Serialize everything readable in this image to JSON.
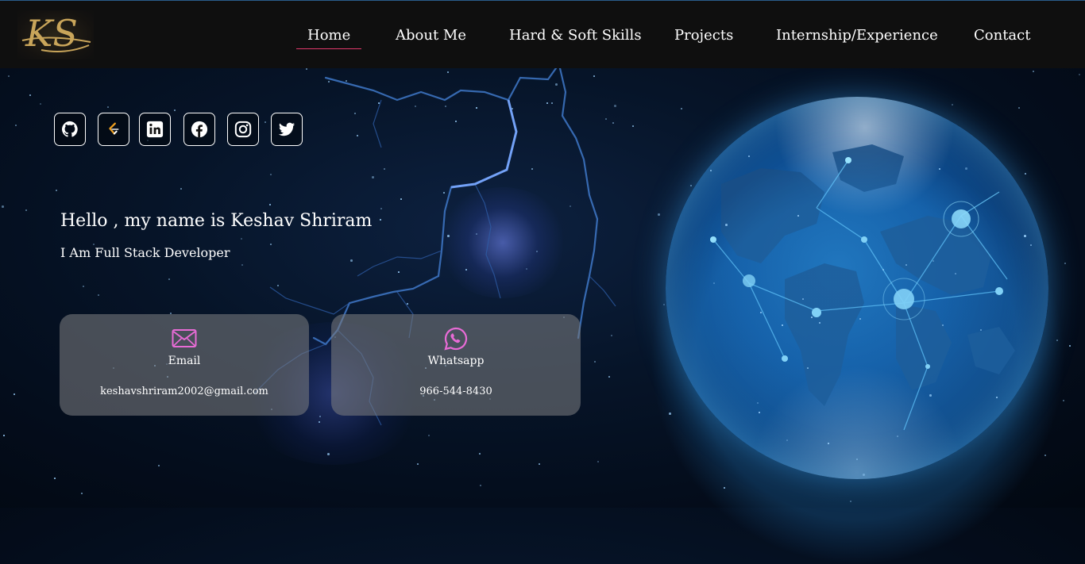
{
  "brand": {
    "logo_text": "KS"
  },
  "nav": {
    "items": [
      {
        "label": "Home",
        "active": true
      },
      {
        "label": "About Me",
        "active": false
      },
      {
        "label": "Hard & Soft Skills",
        "active": false
      },
      {
        "label": "Projects",
        "active": false
      },
      {
        "label": "Internship/Experience",
        "active": false
      },
      {
        "label": "Contact",
        "active": false
      }
    ],
    "active_underline_color": "#e23a6b"
  },
  "socials": [
    {
      "icon": "github-icon"
    },
    {
      "icon": "leetcode-icon"
    },
    {
      "icon": "linkedin-icon"
    },
    {
      "icon": "facebook-icon"
    },
    {
      "icon": "instagram-icon"
    },
    {
      "icon": "twitter-icon"
    }
  ],
  "hero": {
    "greeting": "Hello , my name is Keshav Shriram",
    "role": "I Am Full Stack Developer"
  },
  "contacts": [
    {
      "icon": "email-icon",
      "title": "Email",
      "value": "keshavshriram2002@gmail.com"
    },
    {
      "icon": "whatsapp-icon",
      "title": "Whatsapp",
      "value": "966-544-8430"
    }
  ],
  "colors": {
    "nav_bg": "#0f0f0f",
    "accent_pink": "#e86bd6",
    "logo_gold": "#c9a55a"
  }
}
